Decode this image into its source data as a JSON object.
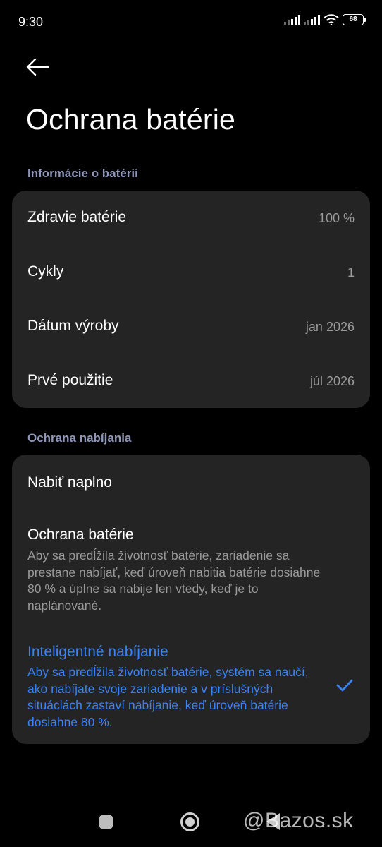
{
  "status_bar": {
    "time": "9:30",
    "battery_level": "68"
  },
  "header": {
    "title": "Ochrana batérie"
  },
  "battery_info": {
    "section_title": "Informácie o batérii",
    "rows": [
      {
        "label": "Zdravie batérie",
        "value": "100 %"
      },
      {
        "label": "Cykly",
        "value": "1"
      },
      {
        "label": "Dátum výroby",
        "value": "jan 2026"
      },
      {
        "label": "Prvé použitie",
        "value": "júl 2026"
      }
    ]
  },
  "charging_protection": {
    "section_title": "Ochrana nabíjania",
    "options": [
      {
        "title": "Nabiť naplno",
        "selected": false
      },
      {
        "title": "Ochrana batérie",
        "description": "Aby sa predĺžila životnosť batérie, zariadenie sa prestane nabíjať, keď úroveň nabitia batérie dosiahne 80 % a úplne sa nabije len vtedy, keď je to naplánované.",
        "selected": false
      },
      {
        "title": "Inteligentné nabíjanie",
        "description": "Aby sa predĺžila životnosť batérie, systém sa naučí, ako nabíjate svoje zariadenie a v príslušných situáciách zastaví nabíjanie, keď úroveň batérie dosiahne 80 %.",
        "selected": true
      }
    ]
  },
  "watermark": "@Bazos.sk",
  "colors": {
    "background": "#000000",
    "card": "#242424",
    "accent": "#3a82f7",
    "section_header": "#8f97b8",
    "secondary_text": "#9a9a9a"
  }
}
